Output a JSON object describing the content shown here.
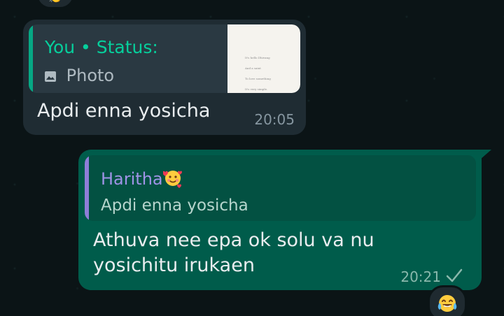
{
  "chat": {
    "top_reaction": {
      "emoji": "👏"
    },
    "incoming_message": {
      "quote_author": "You • Status:",
      "quote_type": "Photo",
      "thumbnail_text": [
        "It's hello Dhivang",
        "And a saint",
        "To love something",
        "It's very simple."
      ],
      "text": "Apdi enna yosicha",
      "time": "20:05"
    },
    "outgoing_message": {
      "quote_author": "Haritha",
      "quote_emoji": "🥰",
      "quote_text": "Apdi enna yosicha",
      "text": "Athuva nee epa ok solu va nu yosichitu irukaen",
      "time": "20:21",
      "status_icon": "single-check-icon",
      "reaction": "😂"
    }
  },
  "colors": {
    "background": "#0b1416",
    "incoming_bubble": "#1f2c33",
    "outgoing_bubble": "#005c4b",
    "status_quote_accent": "#06cf9c",
    "haritha_accent": "#9f93e6"
  }
}
